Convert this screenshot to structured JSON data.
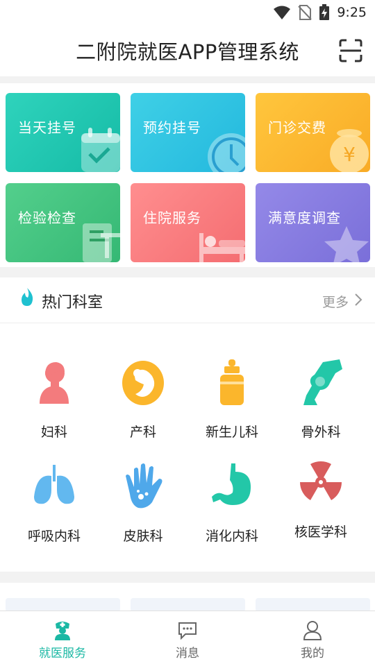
{
  "status_bar": {
    "time": "9:25",
    "icons": [
      "wifi-icon",
      "no-sim-icon",
      "battery-charging-icon"
    ]
  },
  "header": {
    "title": "二附院就医APP管理系统",
    "scan_icon": "scan-icon"
  },
  "quick_actions": [
    {
      "label": "当天挂号",
      "icon": "calendar-check-icon",
      "color": "#22c7b6"
    },
    {
      "label": "预约挂号",
      "icon": "clock-icon",
      "color": "#2ec3e0"
    },
    {
      "label": "门诊交费",
      "icon": "money-bag-icon",
      "color": "#fbb832"
    },
    {
      "label": "检验检查",
      "icon": "test-report-icon",
      "color": "#42c282"
    },
    {
      "label": "住院服务",
      "icon": "hospital-bed-icon",
      "color": "#f87b7e"
    },
    {
      "label": "满意度调查",
      "icon": "star-icon",
      "color": "#8a7fe0"
    }
  ],
  "hot_departments": {
    "title": "热门科室",
    "more_label": "更多",
    "items": [
      {
        "label": "妇科",
        "icon": "woman-icon"
      },
      {
        "label": "产科",
        "icon": "fetus-icon"
      },
      {
        "label": "新生儿科",
        "icon": "baby-bottle-icon"
      },
      {
        "label": "骨外科",
        "icon": "bone-joint-icon"
      },
      {
        "label": "呼吸内科",
        "icon": "lungs-icon"
      },
      {
        "label": "皮肤科",
        "icon": "hand-skin-icon"
      },
      {
        "label": "消化内科",
        "icon": "stomach-icon"
      },
      {
        "label": "核医学科",
        "icon": "radiation-icon"
      }
    ]
  },
  "tab_bar": {
    "tabs": [
      {
        "label": "就医服务",
        "icon": "nurse-icon",
        "active": true
      },
      {
        "label": "消息",
        "icon": "chat-bubble-icon",
        "active": false
      },
      {
        "label": "我的",
        "icon": "user-icon",
        "active": false
      }
    ],
    "active_color": "#1bb8a4"
  }
}
